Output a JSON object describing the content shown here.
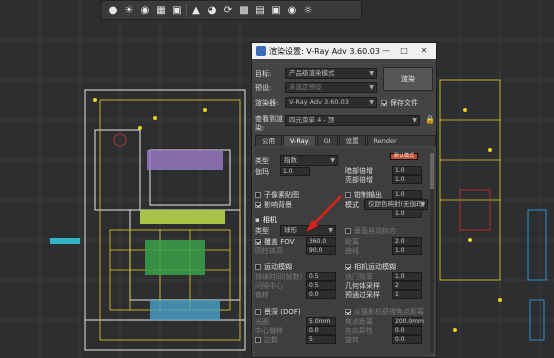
{
  "toolbar": {
    "icons": [
      "lightbulb-icon",
      "sunlight-icon",
      "material-icon",
      "render-setup-icon",
      "rendered-frame-icon",
      "render-icon",
      "teapot-icon",
      "render-iterative-icon",
      "environment-icon",
      "effects-icon",
      "camera-icon",
      "display-icon",
      "light-icon"
    ]
  },
  "dialog": {
    "title": "渲染设置: V-Ray Adv 3.60.03",
    "target_label": "目标:",
    "target_value": "产品级渲染模式",
    "preset_label": "预设:",
    "preset_value": "未选定预设",
    "renderer_label": "渲染器:",
    "renderer_value": "V-Ray Adv 3.60.03",
    "save_file_label": "保存文件",
    "render_button": "渲染",
    "view_label": "查看到渲染:",
    "view_value": "四元菜单 4 - 顶",
    "tabs": [
      "公用",
      "V-Ray",
      "GI",
      "设置",
      "Render Elements"
    ],
    "active_tab": "V-Ray",
    "type_label": "类型",
    "type_value": "指数",
    "swatch_text": "默认模式",
    "gamma_label": "伽玛",
    "gamma_value": "1.0",
    "dark_mult_label": "暗部倍增",
    "dark_mult_value": "1.0",
    "bright_mult_label": "亮部倍增",
    "bright_mult_value": "1.0",
    "sub_pixel_label": "子像素贴图",
    "affect_bg_label": "影响背景",
    "clamp_output_label": "钳制输出",
    "clamp_value": "1.0",
    "mode_label": "模式",
    "mode_value": "仅颜色映射(无伽玛)",
    "linear_value": "1.0",
    "camera_header": "相机",
    "cam_type_label": "类型",
    "cam_type_value": "球形",
    "fov_label": "覆盖 FOV",
    "fov_value": "360.0",
    "auto_fit_label": "垂直自动拟合",
    "height_label": "圆柱体高",
    "height_value": "90.0",
    "dist_label": "距离",
    "dist_value": "2.0",
    "curve_label": "曲线",
    "curve_value": "1.0",
    "motion_blur_label": "运动模糊",
    "cam_motion_label": "相机运动模糊",
    "duration_label": "持续时间(帧数)",
    "duration_value": "0.5",
    "interval_center_label": "间隔中心",
    "interval_center_value": "0.5",
    "bias_label": "偏移",
    "bias_value": "0.0",
    "shutter_label": "快门效率",
    "shutter_value": "1.0",
    "geom_samples_label": "几何体采样",
    "geom_samples_value": "2",
    "prepass_label": "预通过采样",
    "prepass_value": "1",
    "dof_label": "景深 (DOF)",
    "focus_from_cam_label": "从摄影机获得焦点距离",
    "aperture_label": "光圈",
    "aperture_value": "5.0mm",
    "center_bias_label": "中心偏移",
    "center_bias_value": "0.0",
    "focal_dist_label": "焦点距离",
    "focal_dist_value": "200.0mm",
    "anisotropy_label": "各向异性",
    "anisotropy_value": "0.0",
    "sides_label": "边数",
    "sides_value": "5",
    "rotation_label": "旋转",
    "rotation_value": "0.0"
  },
  "colors": {
    "dialog_bg": "#444444",
    "viewport_bg": "#2d2e30",
    "accent_arrow": "#e0201c",
    "swatch": "#c24a2b"
  }
}
